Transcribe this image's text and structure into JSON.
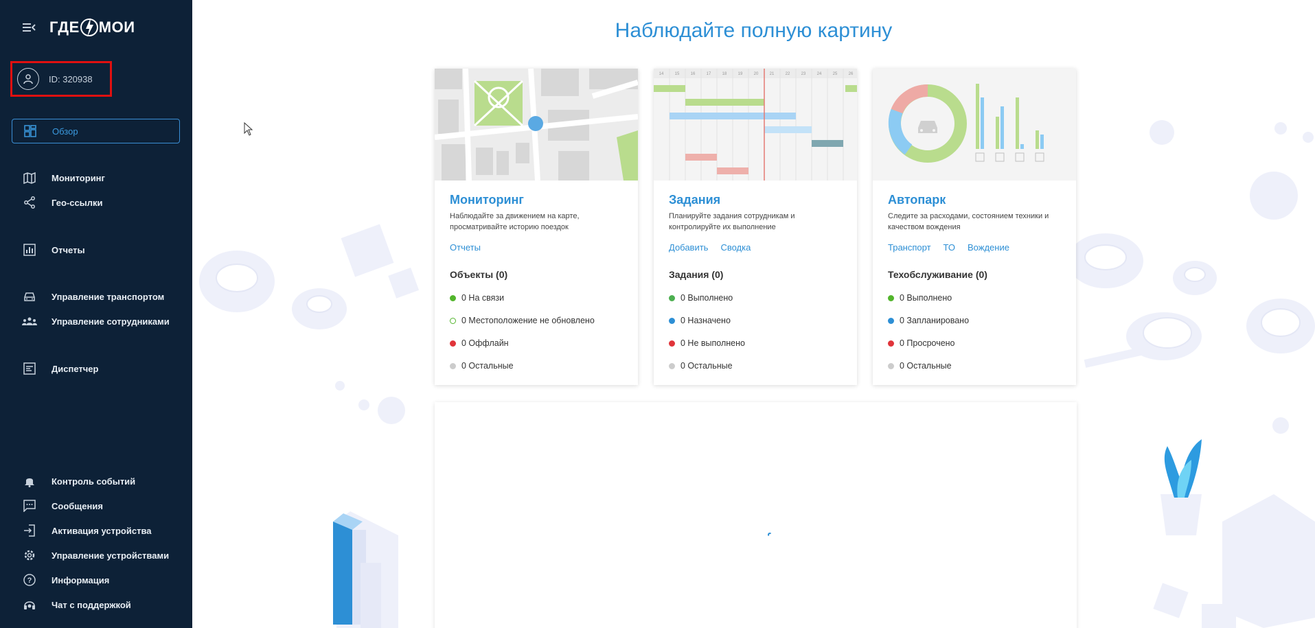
{
  "sidebar": {
    "logo_text": [
      "ГДЕ",
      "МОИ"
    ],
    "profile_id": "ID: 320938",
    "items": [
      {
        "label": "Обзор",
        "icon": "dashboard-icon",
        "active": true
      },
      {
        "label": "Мониторинг",
        "icon": "map-icon"
      },
      {
        "label": "Гео-ссылки",
        "icon": "share-icon"
      },
      {
        "label": "Отчеты",
        "icon": "chart-icon"
      },
      {
        "label": "Управление транспортом",
        "icon": "car-icon"
      },
      {
        "label": "Управление сотрудниками",
        "icon": "people-icon"
      },
      {
        "label": "Диспетчер",
        "icon": "dispatcher-icon"
      },
      {
        "label": "Контроль событий",
        "icon": "bell-icon"
      },
      {
        "label": "Сообщения",
        "icon": "message-icon"
      },
      {
        "label": "Активация устройства",
        "icon": "login-icon"
      },
      {
        "label": "Управление устройствами",
        "icon": "gear-icon"
      },
      {
        "label": "Информация",
        "icon": "help-icon"
      },
      {
        "label": "Чат с поддержкой",
        "icon": "headset-icon"
      }
    ]
  },
  "main": {
    "headline": "Наблюдайте полную картину",
    "cards": [
      {
        "title": "Мониторинг",
        "desc": "Наблюдайте за движением на карте, просматривайте историю поездок",
        "links": [
          "Отчеты"
        ],
        "section": "Объекты (0)",
        "stats": [
          {
            "text": "0 На связи",
            "color": "#52b52c",
            "hollow": false
          },
          {
            "text": "0 Местоположение не обновлено",
            "color": "#52b52c",
            "hollow": true
          },
          {
            "text": "0 Оффлайн",
            "color": "#e0343a",
            "hollow": false
          },
          {
            "text": "0 Остальные",
            "color": "#cccccc",
            "hollow": false
          }
        ]
      },
      {
        "title": "Задания",
        "desc": "Планируйте задания сотрудникам и контролируйте их выполнение",
        "links": [
          "Добавить",
          "Сводка"
        ],
        "section": "Задания (0)",
        "stats": [
          {
            "text": "0 Выполнено",
            "color": "#4caf50",
            "hollow": false
          },
          {
            "text": "0 Назначено",
            "color": "#2d8fd5",
            "hollow": false
          },
          {
            "text": "0 Не выполнено",
            "color": "#e0343a",
            "hollow": false
          },
          {
            "text": "0 Остальные",
            "color": "#cccccc",
            "hollow": false
          }
        ]
      },
      {
        "title": "Автопарк",
        "desc": "Следите за расходами, состоянием техники и качеством вождения",
        "links": [
          "Транспорт",
          "ТО",
          "Вождение"
        ],
        "section": "Техобслуживание (0)",
        "stats": [
          {
            "text": "0 Выполнено",
            "color": "#52b52c",
            "hollow": false
          },
          {
            "text": "0 Запланировано",
            "color": "#2d8fd5",
            "hollow": false
          },
          {
            "text": "0 Просрочено",
            "color": "#e0343a",
            "hollow": false
          },
          {
            "text": "0 Остальные",
            "color": "#cccccc",
            "hollow": false
          }
        ]
      }
    ],
    "gantt_days": [
      "14",
      "15",
      "16",
      "17",
      "18",
      "19",
      "20",
      "21",
      "22",
      "23",
      "24",
      "25",
      "26"
    ]
  },
  "colors": {
    "sidebar_bg": "#0d2137",
    "accent": "#2d8fd5",
    "highlight_border": "#e01010"
  }
}
